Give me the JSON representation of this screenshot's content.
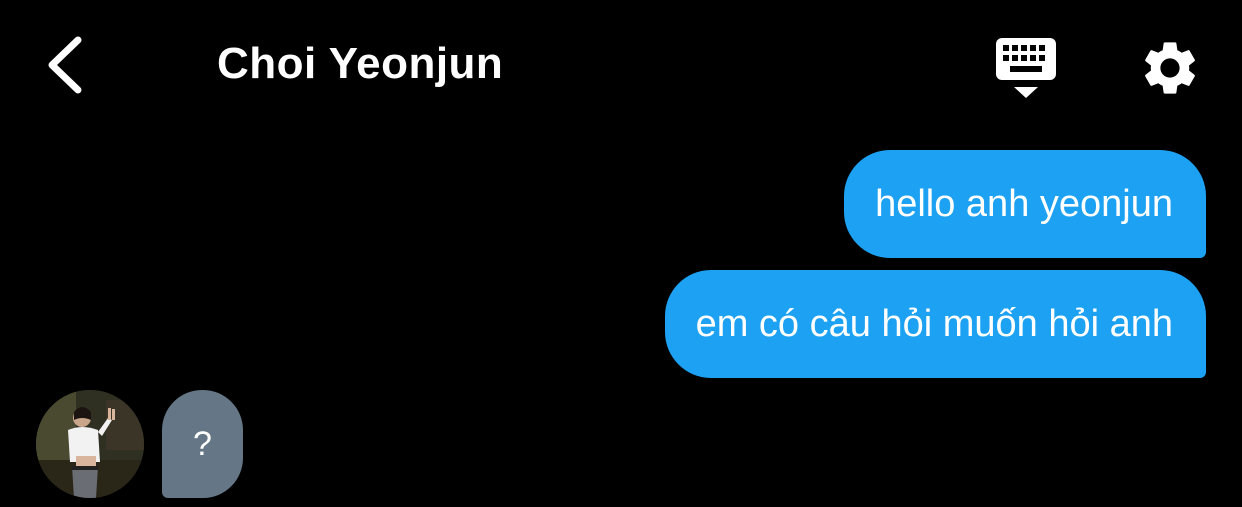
{
  "header": {
    "back_icon": "chevron-left-icon",
    "title": "Choi Yeonjun",
    "keyboard_icon": "keyboard-hide-icon",
    "settings_icon": "gear-icon"
  },
  "messages": {
    "outgoing": [
      {
        "text": "hello anh yeonjun"
      },
      {
        "text": "em có câu hỏi muốn hỏi anh"
      }
    ],
    "incoming": [
      {
        "text": "?"
      }
    ]
  },
  "colors": {
    "background": "#000000",
    "outgoing_bubble": "#1da1f2",
    "incoming_bubble": "#657786",
    "text": "#ffffff"
  }
}
